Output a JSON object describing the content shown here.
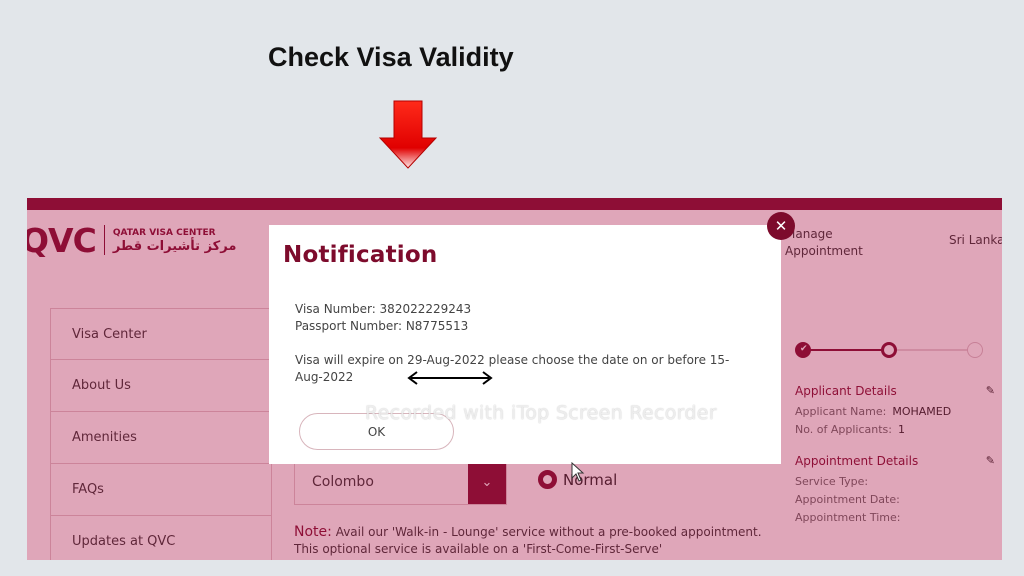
{
  "slide_title": "Check Visa Validity",
  "logo": {
    "mark": "QVC",
    "name_en": "QATAR VISA CENTER",
    "name_ar": "مركز تأشيرات قطر"
  },
  "nav": {
    "manage": "Manage Appointment",
    "country": "Sri Lanka"
  },
  "sidebar": {
    "items": [
      {
        "label": "Visa Center"
      },
      {
        "label": "About Us"
      },
      {
        "label": "Amenities"
      },
      {
        "label": "FAQs"
      },
      {
        "label": "Updates at QVC"
      }
    ]
  },
  "form": {
    "city": "Colombo",
    "service_option": "Normal"
  },
  "note": {
    "label": "Note:",
    "text": "Avail our 'Walk-in - Lounge' service without a pre-booked appointment. This optional service is available on a 'First-Come-First-Serve'"
  },
  "summary": {
    "applicant_heading": "Applicant Details",
    "applicant_name_label": "Applicant Name:",
    "applicant_name": "MOHAMED",
    "applicants_label": "No. of Applicants:",
    "applicants": "1",
    "appointment_heading": "Appointment Details",
    "service_type_label": "Service Type:",
    "appointment_date_label": "Appointment Date:",
    "appointment_time_label": "Appointment Time:"
  },
  "steps": {
    "completed": 2,
    "total": 3
  },
  "modal": {
    "title": "Notification",
    "visa_number": "Visa Number: 382022229243",
    "passport_number": "Passport Number: N8775513",
    "message": "Visa will expire on 29-Aug-2022 please choose the date on or before 15-Aug-2022",
    "ok_label": "OK"
  },
  "watermark": "Recorded with iTop Screen Recorder",
  "colors": {
    "brand": "#7d0b2c",
    "overlay": "#aa1446",
    "arrow": "#e00000",
    "background": "#e2e6ea"
  },
  "icons": {
    "down_arrow": "red-down-arrow-icon",
    "double_arrow": "double-headed-arrow-icon",
    "close": "close-icon",
    "pencil": "pencil-icon",
    "check": "check-icon",
    "chevron": "chevron-down-icon",
    "cursor": "mouse-cursor-icon"
  }
}
